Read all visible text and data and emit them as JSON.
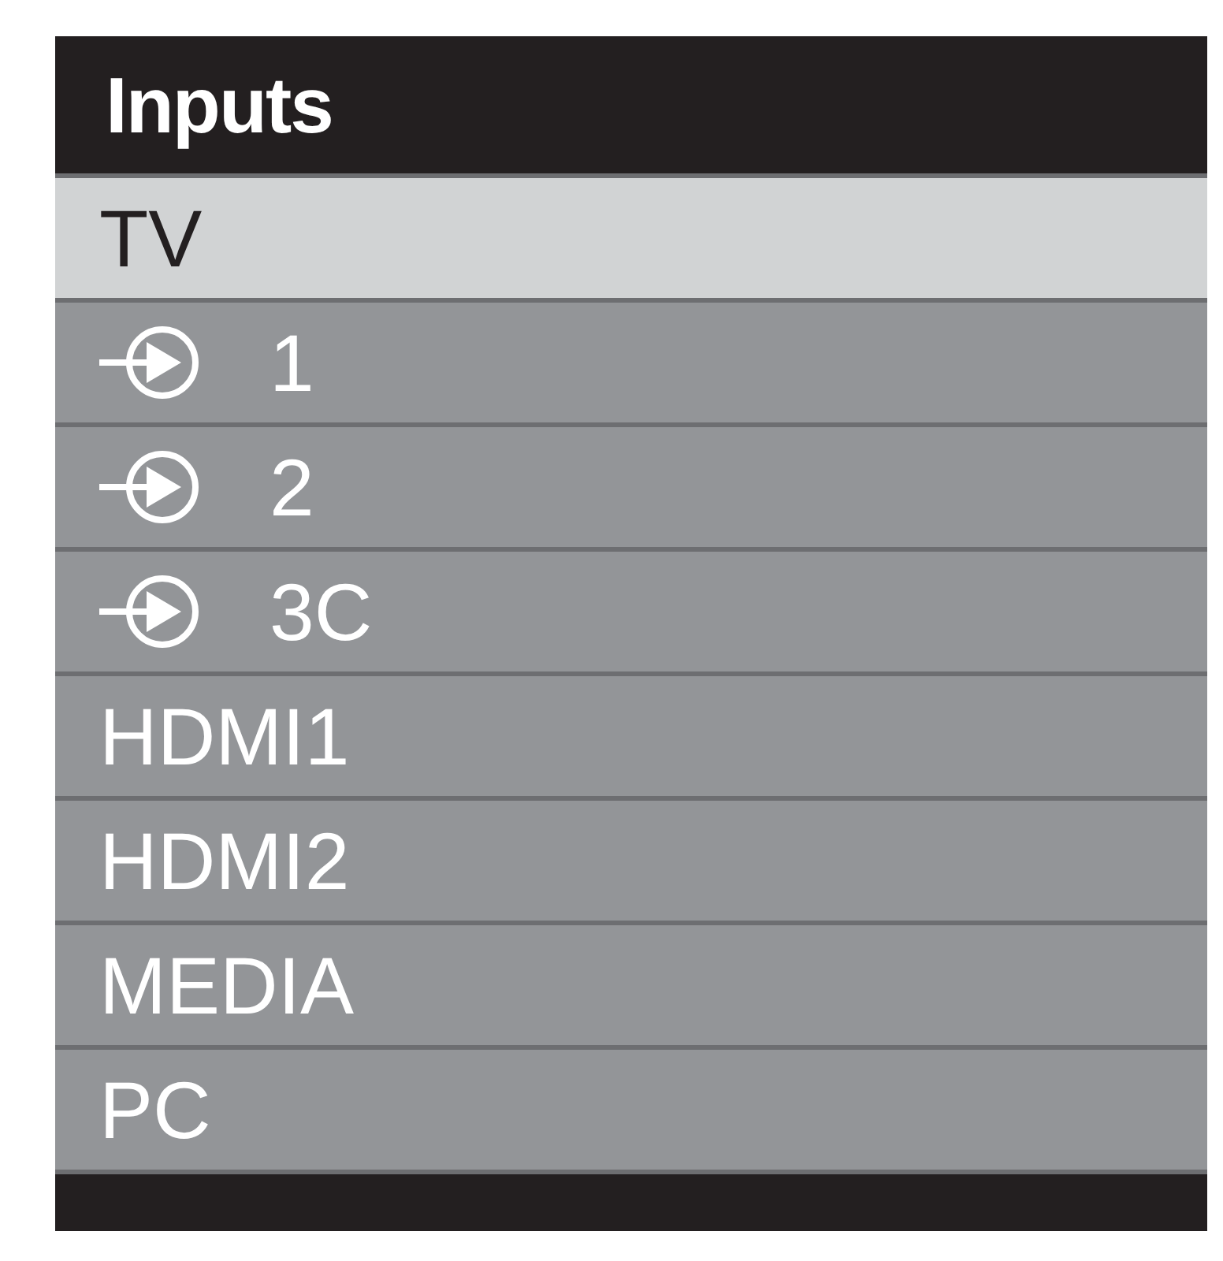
{
  "menu": {
    "title": "Inputs"
  },
  "items": [
    {
      "label": "TV",
      "kind": "plain",
      "selected": true
    },
    {
      "label": "1",
      "kind": "input",
      "selected": false
    },
    {
      "label": "2",
      "kind": "input",
      "selected": false
    },
    {
      "label": "3C",
      "kind": "input",
      "selected": false
    },
    {
      "label": "HDMI1",
      "kind": "plain",
      "selected": false
    },
    {
      "label": "HDMI2",
      "kind": "plain",
      "selected": false
    },
    {
      "label": "MEDIA",
      "kind": "plain",
      "selected": false
    },
    {
      "label": "PC",
      "kind": "plain",
      "selected": false
    }
  ]
}
